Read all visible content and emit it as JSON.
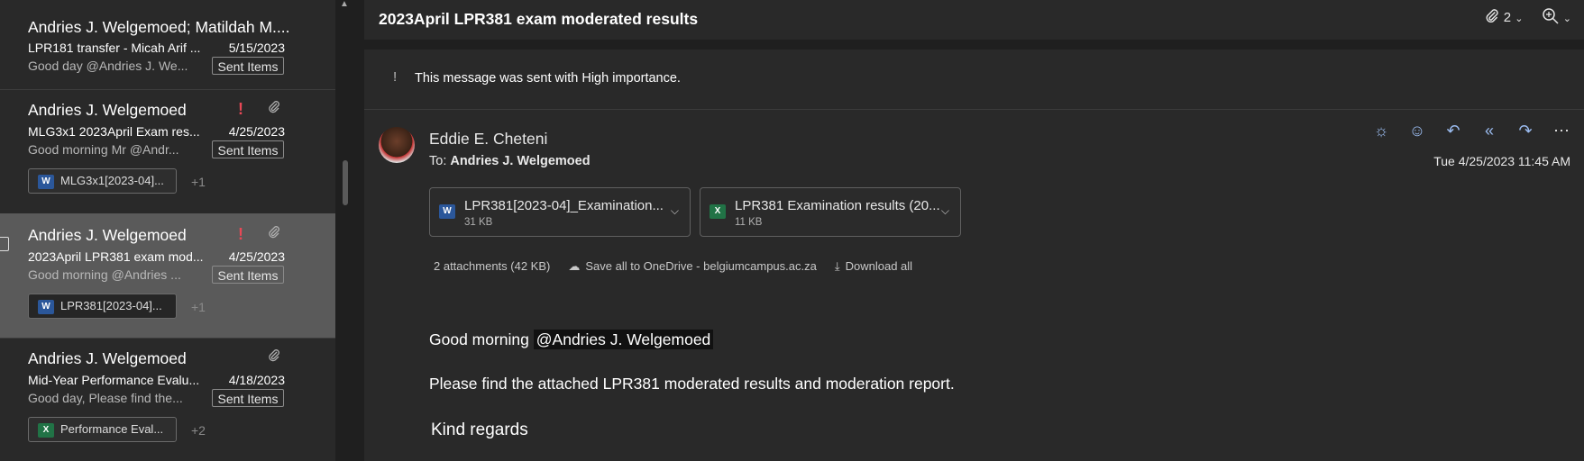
{
  "message_list": {
    "items": [
      {
        "sender": "Andries J. Welgemoed; Matildah M....",
        "subject": "LPR181 transfer - Micah Arif ...",
        "date": "5/15/2023",
        "preview": "Good day @Andries J. We...",
        "folder": "Sent Items"
      },
      {
        "sender": "Andries J. Welgemoed",
        "subject": "MLG3x1 2023April Exam res...",
        "date": "4/25/2023",
        "preview": "Good morning Mr @Andr...",
        "folder": "Sent Items",
        "attachment_chip": "MLG3x1[2023-04]...",
        "more": "+1",
        "high_importance": true,
        "has_attachment": true
      },
      {
        "sender": "Andries J. Welgemoed",
        "subject": "2023April LPR381 exam mod...",
        "date": "4/25/2023",
        "preview": "Good morning @Andries ...",
        "folder": "Sent Items",
        "attachment_chip": "LPR381[2023-04]...",
        "more": "+1",
        "high_importance": true,
        "has_attachment": true,
        "selected": true
      },
      {
        "sender": "Andries J. Welgemoed",
        "subject": "Mid-Year Performance Evalu...",
        "date": "4/18/2023",
        "preview": "Good day, Please find the...",
        "folder": "Sent Items",
        "attachment_chip": "Performance Eval...",
        "more": "+2",
        "has_attachment": true
      }
    ]
  },
  "reading_pane": {
    "title": "2023April LPR381 exam moderated results",
    "attachment_count": "2",
    "importance_notice": "This message was sent with High importance.",
    "from": "Eddie E. Cheteni",
    "to_label": "To:",
    "to": "Andries J. Welgemoed",
    "datetime": "Tue 4/25/2023 11:45 AM",
    "attachments": [
      {
        "name": "LPR381[2023-04]_Examination...",
        "size": "31 KB",
        "type": "word"
      },
      {
        "name": "LPR381 Examination results (20...",
        "size": "11 KB",
        "type": "excel"
      }
    ],
    "attachment_summary": "2 attachments (42 KB)",
    "save_all": "Save all to OneDrive - belgiumcampus.ac.za",
    "download_all": "Download all",
    "body": {
      "greeting": "Good morning",
      "mention": "@Andries J. Welgemoed",
      "line1": "Please find the attached LPR381 moderated results and moderation report.",
      "closing": "Kind regards"
    }
  },
  "icons": {
    "word_letter": "W",
    "excel_letter": "X"
  },
  "colors": {
    "importance": "#e74856",
    "action_icons": "#9bbcf0",
    "word": "#2b579a",
    "excel": "#217346"
  }
}
